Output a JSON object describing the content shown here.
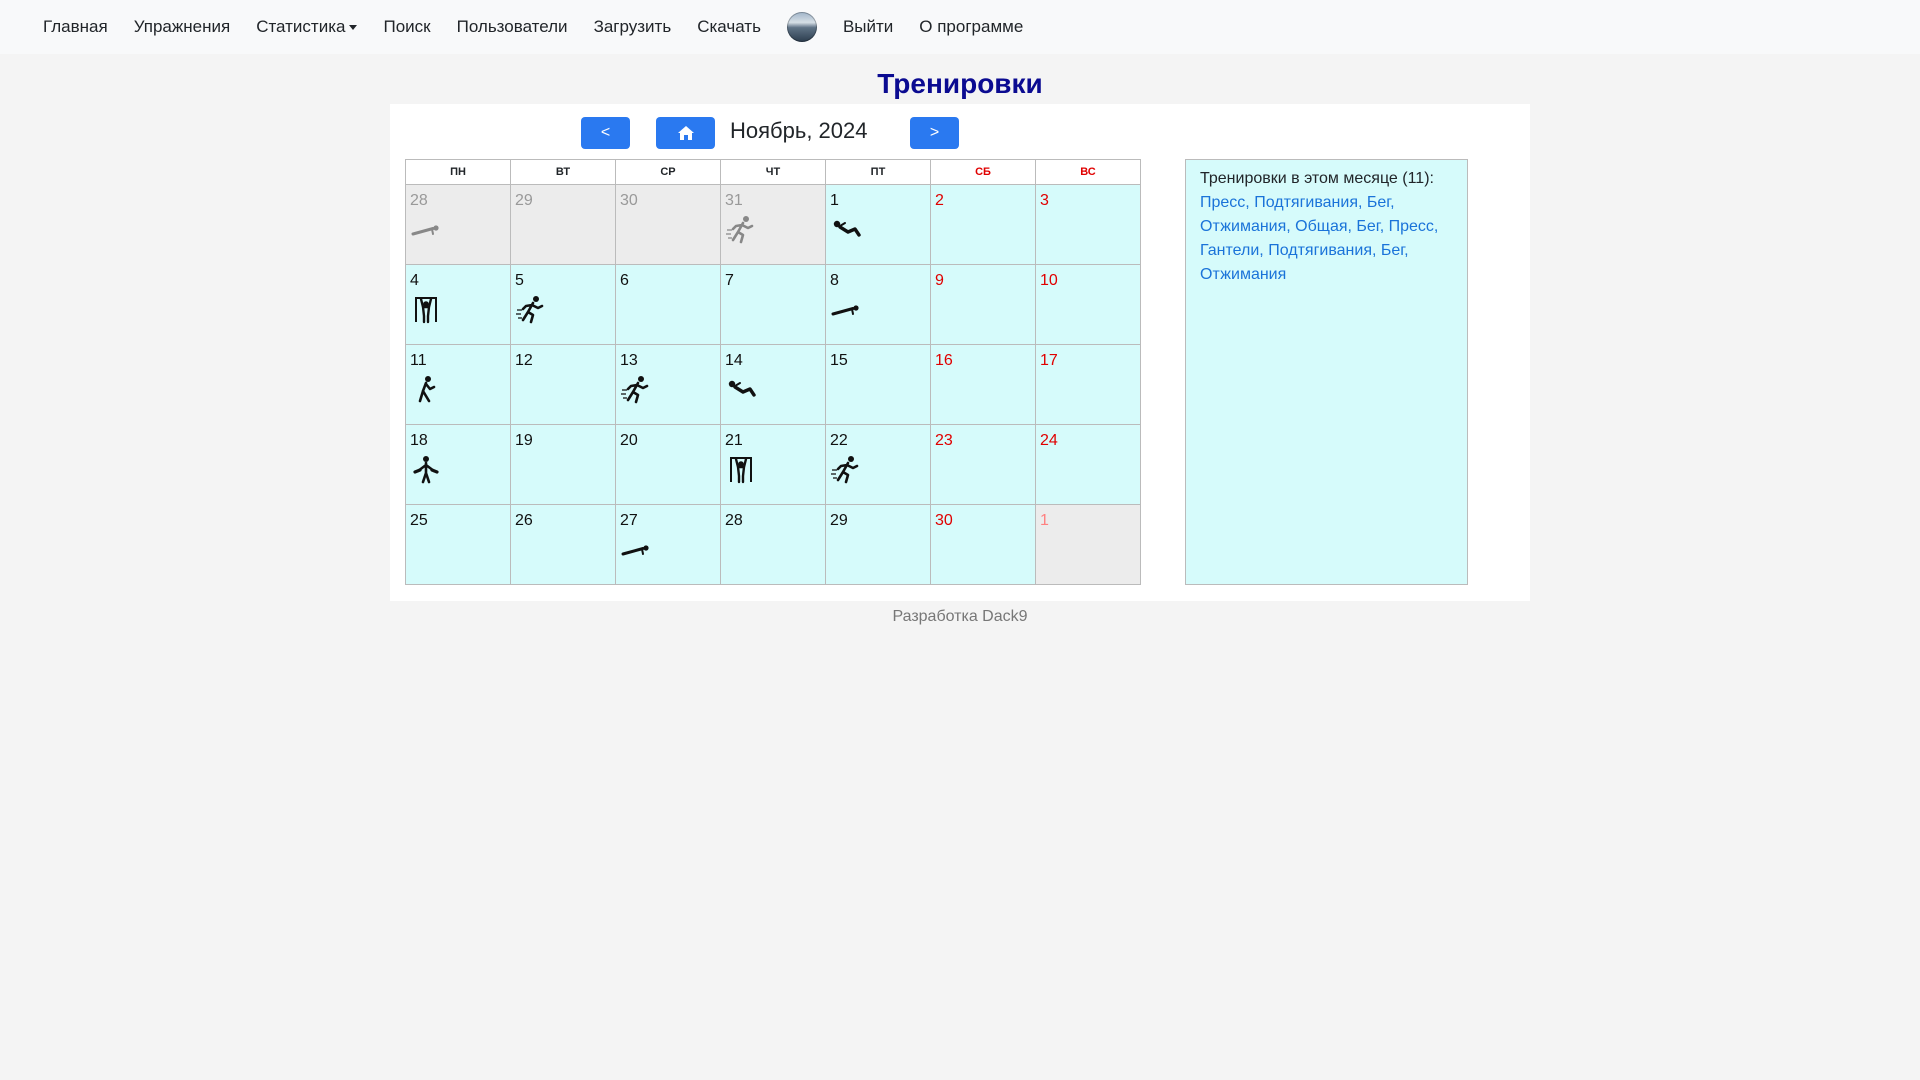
{
  "nav": {
    "items": [
      "Главная",
      "Упражнения",
      "Статистика",
      "Поиск",
      "Пользователи",
      "Загрузить",
      "Скачать"
    ],
    "logout": "Выйти",
    "about": "О программе"
  },
  "page_title": "Тренировки",
  "calendar": {
    "month_label": "Ноябрь, 2024",
    "prev_label": "<",
    "next_label": ">",
    "weekdays": [
      "ПН",
      "ВТ",
      "СР",
      "ЧТ",
      "ПТ",
      "СБ",
      "ВС"
    ],
    "weeks": [
      [
        {
          "day": "28",
          "other": true,
          "icon": "plank-icon"
        },
        {
          "day": "29",
          "other": true
        },
        {
          "day": "30",
          "other": true
        },
        {
          "day": "31",
          "other": true,
          "icon": "running-icon"
        },
        {
          "day": "1",
          "icon": "situps-icon"
        },
        {
          "day": "2"
        },
        {
          "day": "3"
        }
      ],
      [
        {
          "day": "4",
          "icon": "pullups-icon"
        },
        {
          "day": "5",
          "icon": "running-icon"
        },
        {
          "day": "6"
        },
        {
          "day": "7"
        },
        {
          "day": "8",
          "icon": "plank-icon"
        },
        {
          "day": "9"
        },
        {
          "day": "10"
        }
      ],
      [
        {
          "day": "11",
          "icon": "stretching-icon"
        },
        {
          "day": "12"
        },
        {
          "day": "13",
          "icon": "running-icon"
        },
        {
          "day": "14",
          "icon": "situps-icon"
        },
        {
          "day": "15"
        },
        {
          "day": "16"
        },
        {
          "day": "17"
        }
      ],
      [
        {
          "day": "18",
          "icon": "dumbbells-icon"
        },
        {
          "day": "19"
        },
        {
          "day": "20"
        },
        {
          "day": "21",
          "icon": "pullups-icon"
        },
        {
          "day": "22",
          "icon": "running-icon"
        },
        {
          "day": "23"
        },
        {
          "day": "24"
        }
      ],
      [
        {
          "day": "25"
        },
        {
          "day": "26"
        },
        {
          "day": "27",
          "icon": "plank-icon"
        },
        {
          "day": "28"
        },
        {
          "day": "29"
        },
        {
          "day": "30"
        },
        {
          "day": "1",
          "other": true
        }
      ]
    ]
  },
  "summary": {
    "heading": "Тренировки в этом месяце (11):",
    "items": [
      "Пресс",
      "Подтягивания",
      "Бег",
      "Отжимания",
      "Общая",
      "Бег",
      "Пресс",
      "Гантели",
      "Подтягивания",
      "Бег",
      "Отжимания"
    ]
  },
  "footer": "Разработка Dack9"
}
